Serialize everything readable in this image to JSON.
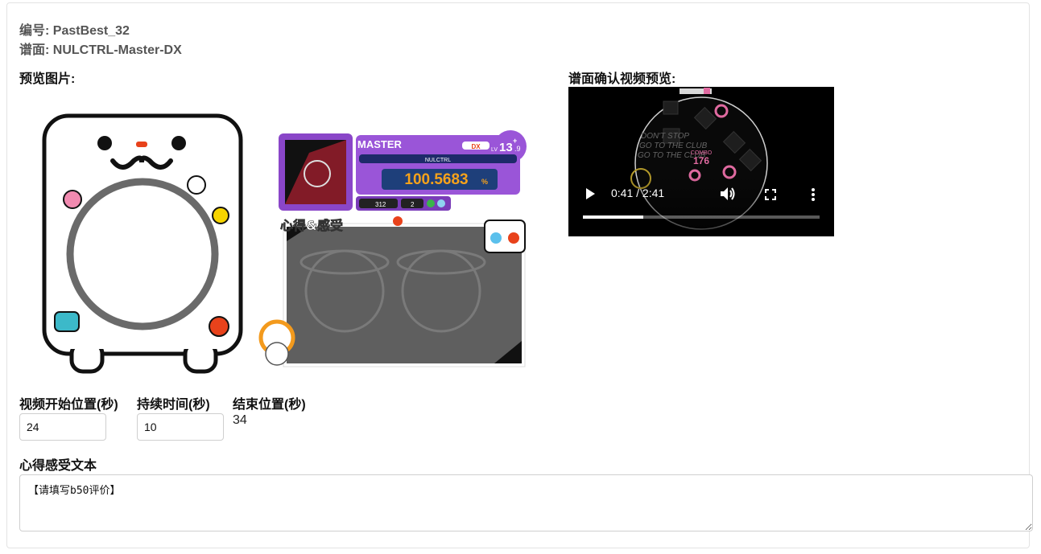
{
  "header": {
    "id_line": "编号: PastBest_32",
    "chart_line": "谱面: NULCTRL-Master-DX"
  },
  "preview": {
    "label": "预览图片:",
    "card": {
      "difficulty": "MASTER",
      "dx_tag": "DX",
      "level_prefix": "LV",
      "level": "13",
      "level_sup": "+",
      "level_sub": ".9",
      "song": "NULCTRL",
      "achievement": "100.5683",
      "achievement_unit": "%",
      "stat_a": "312",
      "stat_b": "2",
      "comment_title": "心得&感受"
    }
  },
  "video_preview": {
    "label": "谱面确认视频预览:",
    "time_display": "0:41 / 2:41",
    "progress": 0.255,
    "overlay_lines": [
      "DON'T STOP",
      "GO TO THE CLUB",
      "GO TO THE CLUB"
    ],
    "combo_label": "COMBO",
    "combo_value": "176",
    "icons": [
      "play-icon",
      "volume-icon",
      "fullscreen-icon",
      "more-icon"
    ]
  },
  "form": {
    "start_label": "视频开始位置(秒)",
    "start_value": "24",
    "duration_label": "持续时间(秒)",
    "duration_value": "10",
    "end_label": "结束位置(秒)",
    "end_value": "34",
    "comment_label": "心得感受文本",
    "comment_value": "【请填写b50评价】"
  }
}
